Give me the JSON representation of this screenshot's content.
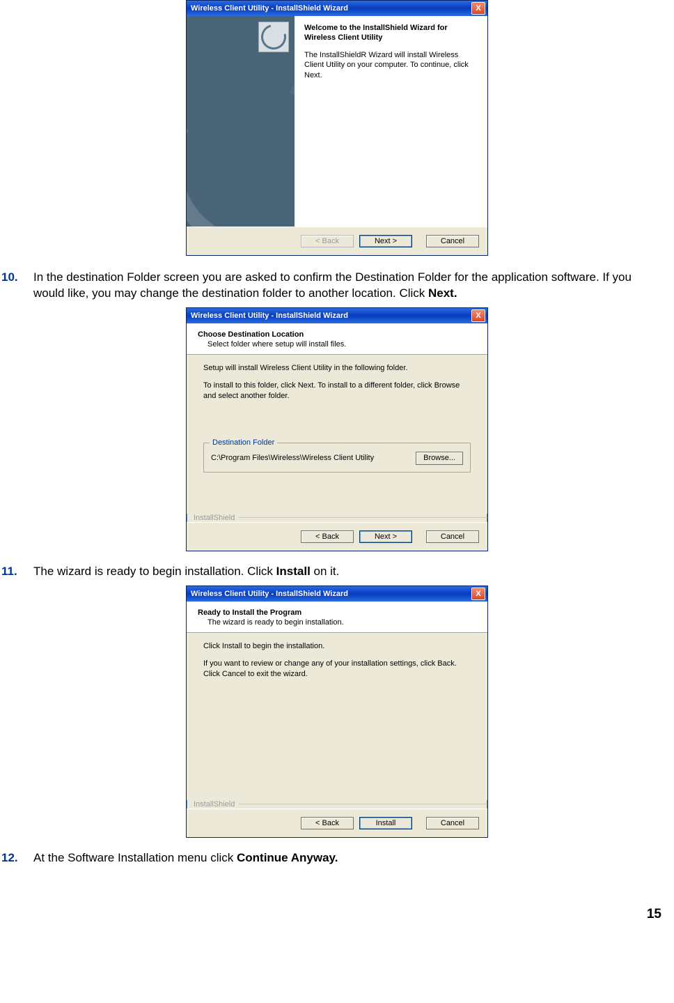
{
  "pageNumber": "15",
  "steps": {
    "s10": {
      "num": "10.",
      "text_a": "In the destination Folder screen you are asked to confirm the Destination Folder for the application software. If you would like, you may change the destination folder to another location. Click ",
      "text_b": "Next."
    },
    "s11": {
      "num": "11.",
      "text_a": "The wizard is ready to begin installation. Click ",
      "text_b": "Install",
      "text_c": " on it."
    },
    "s12": {
      "num": "12.",
      "text_a": "At the Software Installation menu click ",
      "text_b": "Continue Anyway."
    }
  },
  "wizard": {
    "title": "Wireless Client Utility - InstallShield Wizard",
    "closeGlyph": "X",
    "installshield_label": "InstallShield",
    "buttons": {
      "back": "< Back",
      "next": "Next >",
      "install": "Install",
      "cancel": "Cancel",
      "browse": "Browse..."
    }
  },
  "fig1": {
    "heading": "Welcome to the InstallShield Wizard for Wireless Client Utility",
    "para": "The InstallShieldR Wizard will install Wireless Client Utility on your computer.  To continue, click Next."
  },
  "fig2": {
    "header_title": "Choose Destination Location",
    "header_sub": "Select folder where setup will install files.",
    "body_p1": "Setup will install Wireless Client Utility in the following folder.",
    "body_p2": "To install to this folder, click Next. To install to a different folder, click Browse and select another folder.",
    "group_legend": "Destination Folder",
    "path": "C:\\Program Files\\Wireless\\Wireless Client Utility"
  },
  "fig3": {
    "header_title": "Ready to Install the Program",
    "header_sub": "The wizard is ready to begin installation.",
    "body_p1": "Click Install to begin the installation.",
    "body_p2": "If you want to review or change any of your installation settings, click Back. Click Cancel to exit the wizard."
  }
}
